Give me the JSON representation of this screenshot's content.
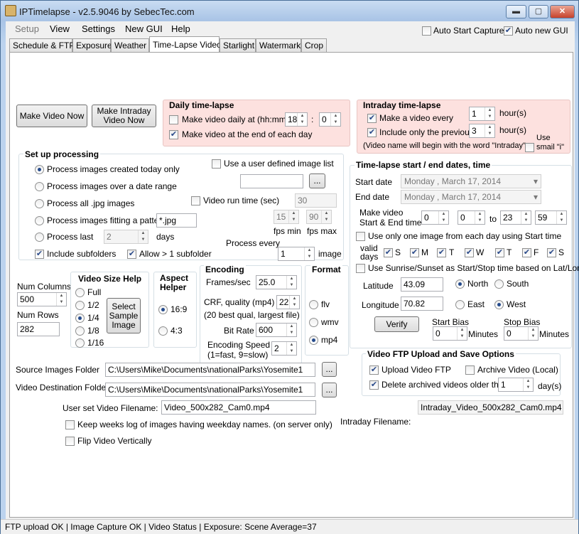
{
  "window": {
    "title": "IPTimelapse - v2.5.9046 by SebecTec.com",
    "minimize": "▬",
    "maximize": "▢",
    "close": "✕"
  },
  "menu": {
    "setup": "Setup",
    "view": "View",
    "settings": "Settings",
    "new_gui": "New GUI",
    "help": "Help"
  },
  "top_options": {
    "auto_start": "Auto Start Capture",
    "auto_new_gui": "Auto new GUI"
  },
  "tabs": [
    "Schedule & FTP",
    "Exposure",
    "Weather",
    "Time-Lapse Video",
    "Starlight",
    "Watermark",
    "Crop"
  ],
  "buttons": {
    "make_video": "Make Video Now",
    "make_intraday": "Make Intraday Video Now",
    "browse": "...",
    "select_sample": "Select Sample Image",
    "verify": "Verify"
  },
  "daily": {
    "title": "Daily time-lapse",
    "make_daily": "Make video daily at (hh:mm)",
    "hour": "18",
    "colon": ":",
    "minute": "0",
    "make_end_day": "Make video at the end of each day"
  },
  "intraday": {
    "title": "Intraday time-lapse",
    "make_every": "Make a video every",
    "every_val": "1",
    "hours1": "hour(s)",
    "include_prev": "Include only the previous",
    "prev_val": "3",
    "hours2": "hour(s)",
    "note": "(Video name will begin with the word \"Intraday\"",
    "use_small": "Use smail \"i\""
  },
  "processing": {
    "title": "Set up processing",
    "r1": "Process images created today only",
    "r2": "Process images over a date range",
    "r3": "Process all .jpg images",
    "r4": "Process images fitting a pattern",
    "pattern": "*.jpg",
    "r5": "Process last",
    "last_val": "2",
    "days": "days",
    "include_sub": "Include subfolders",
    "allow_sub": "Allow > 1 subfolder",
    "user_list": "Use a user defined image list",
    "run_time": "Video run time (sec)",
    "run_val": "30",
    "fps_min_val": "15",
    "fps_max_val": "90",
    "fps_min": "fps min",
    "fps_max": "fps max",
    "process_every": "Process every",
    "every_val": "1",
    "image": "image"
  },
  "dates": {
    "title": "Time-lapse start / end dates, time",
    "start_date": "Start date",
    "start_val": "Monday   ,   March   17, 2014",
    "end_date": "End date",
    "end_val": "Monday   ,   March   17, 2014",
    "make_video": "Make video",
    "start_end_time": "Start & End time",
    "sh": "0",
    "sm": "0",
    "to": "to",
    "eh": "23",
    "em": "59",
    "one_image": "Use only one image from each day using Start time",
    "valid": "valid",
    "days": "days",
    "weekdays": [
      "S",
      "M",
      "T",
      "W",
      "T",
      "F",
      "S"
    ],
    "sunrise": "Use Sunrise/Sunset as Start/Stop time based on Lat/Long",
    "latitude": "Latitude",
    "lat_val": "43.09",
    "north": "North",
    "south": "South",
    "longitude": "Longitude",
    "lon_val": "70.82",
    "east": "East",
    "west": "West",
    "start_bias": "Start Bias",
    "start_bias_val": "0",
    "stop_bias": "Stop Bias",
    "stop_bias_val": "0",
    "minutes": "Minutes"
  },
  "dims": {
    "num_columns": "Num Columns",
    "cols_val": "500",
    "num_rows": "Num Rows",
    "rows_val": "282"
  },
  "video_size": {
    "title": "Video Size Help",
    "full": "Full",
    "half": "1/2",
    "quarter": "1/4",
    "eighth": "1/8",
    "sixteenth": "1/16"
  },
  "aspect": {
    "title": "Aspect Helper",
    "a169": "16:9",
    "a43": "4:3"
  },
  "encoding": {
    "title": "Encoding",
    "fps_label": "Frames/sec",
    "fps_val": "25.0",
    "crf_label": "CRF, quality (mp4)",
    "crf_val": "22",
    "crf_note": "(20 best qual, largest file)",
    "bitrate_label": "Bit Rate",
    "bitrate_val": "600",
    "speed_label": "Encoding Speed",
    "speed_note": "(1=fast, 9=slow)",
    "speed_val": "2"
  },
  "format": {
    "title": "Format",
    "flv": "flv",
    "wmv": "wmv",
    "mp4": "mp4"
  },
  "ftp": {
    "title": "Video FTP Upload and Save Options",
    "upload": "Upload Video FTP",
    "archive": "Archive Video (Local)",
    "delete": "Delete archived videos older than",
    "delete_val": "1",
    "days": "day(s)"
  },
  "folders": {
    "source_label": "Source Images Folder",
    "source_val": "C:\\Users\\Mike\\Documents\\nationalParks\\Yosemite1",
    "dest_label": "Video Destination Folder",
    "dest_val": "C:\\Users\\Mike\\Documents\\nationalParks\\Yosemite1",
    "user_filename_label": "User set Video Filename:",
    "user_filename_val": "Video_500x282_Cam0.mp4",
    "intraday_filename_label": "Intraday Filename:",
    "intraday_filename_val": "Intraday_Video_500x282_Cam0.mp4"
  },
  "options": {
    "weeks_log": "Keep weeks log of images having weekday names. (on server only)",
    "flip": "Flip Video Vertically"
  },
  "status": "FTP upload OK |  Image Capture OK  | Video Status  | Exposure: Scene Average=37"
}
